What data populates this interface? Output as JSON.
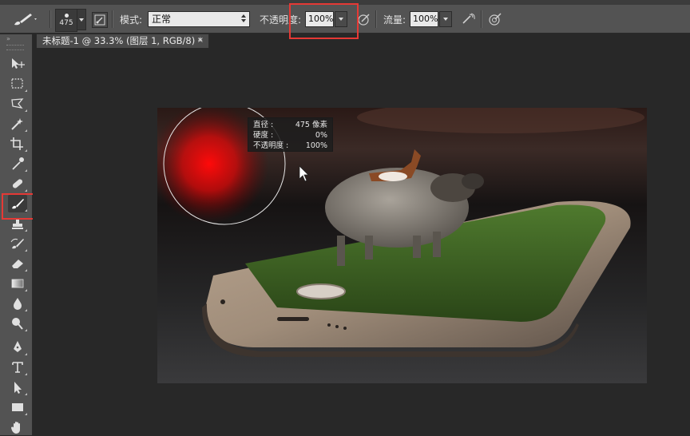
{
  "options_bar": {
    "brush_size": "475",
    "mode_label": "模式:",
    "mode_value": "正常",
    "opacity_label": "不透明度:",
    "opacity_value": "100%",
    "flow_label": "流量:",
    "flow_value": "100%"
  },
  "document": {
    "tab_title": "未标题-1 @ 33.3% (图层 1, RGB/8) *",
    "close_glyph": "×"
  },
  "brush_hud": {
    "rows": [
      {
        "label": "直径 :",
        "value": "475 像素"
      },
      {
        "label": "硬度 :",
        "value": "0%"
      },
      {
        "label": "不透明度 :",
        "value": "100%"
      }
    ]
  },
  "tools": [
    {
      "name": "move-tool-icon"
    },
    {
      "name": "marquee-tool-icon"
    },
    {
      "name": "lasso-tool-icon"
    },
    {
      "name": "magic-wand-tool-icon"
    },
    {
      "name": "crop-tool-icon"
    },
    {
      "name": "eyedropper-tool-icon"
    },
    {
      "name": "healing-brush-tool-icon"
    },
    {
      "name": "brush-tool-icon",
      "active": true
    },
    {
      "name": "clone-stamp-tool-icon"
    },
    {
      "name": "history-brush-tool-icon"
    },
    {
      "name": "eraser-tool-icon"
    },
    {
      "name": "gradient-tool-icon"
    },
    {
      "name": "blur-tool-icon"
    },
    {
      "name": "dodge-tool-icon"
    },
    {
      "name": "pen-tool-icon"
    },
    {
      "name": "type-tool-icon"
    },
    {
      "name": "path-selection-tool-icon"
    },
    {
      "name": "rectangle-tool-icon"
    },
    {
      "name": "hand-tool-icon"
    }
  ],
  "colors": {
    "highlight": "#e53935",
    "panel_bg": "#535353",
    "canvas_bg": "#282828"
  }
}
